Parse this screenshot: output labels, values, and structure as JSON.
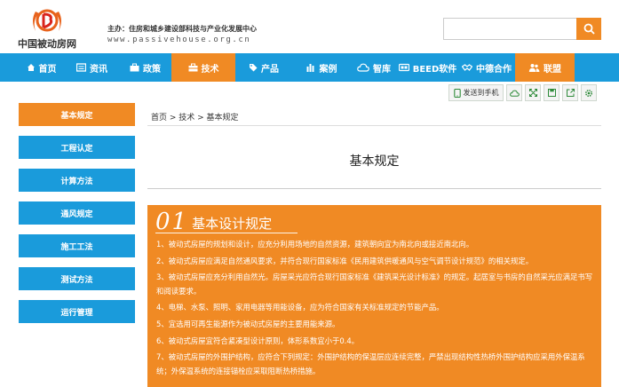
{
  "header": {
    "logo_text": "中国被动房网",
    "sponsor": "主办：住房和城乡建设部科技与产业化发展中心",
    "url": "www.passivehouse.org.cn",
    "search": {
      "placeholder": ""
    }
  },
  "nav": {
    "items": [
      {
        "label": "首页",
        "icon": "home-icon"
      },
      {
        "label": "资讯",
        "icon": "news-icon"
      },
      {
        "label": "政策",
        "icon": "briefcase-icon"
      },
      {
        "label": "技术",
        "icon": "toolbox-icon",
        "active": true
      },
      {
        "label": "产品",
        "icon": "tag-icon"
      },
      {
        "label": "案例",
        "icon": "bar-chart-icon"
      },
      {
        "label": "智库",
        "icon": "cloud-icon"
      },
      {
        "label": "BEED软件",
        "icon": "beed-icon"
      },
      {
        "label": "中德合作",
        "icon": "handshake-icon"
      },
      {
        "label": "联盟",
        "icon": "group-icon"
      }
    ]
  },
  "toolbar": {
    "send_label": "发送到手机"
  },
  "sidebar": {
    "items": [
      {
        "label": "基本规定",
        "active": true
      },
      {
        "label": "工程认定"
      },
      {
        "label": "计算方法"
      },
      {
        "label": "通风规定"
      },
      {
        "label": "施工工法"
      },
      {
        "label": "测试方法"
      },
      {
        "label": "运行管理"
      }
    ]
  },
  "breadcrumb": "首页 > 技术 > 基本规定",
  "page_title": "基本规定",
  "section": {
    "number": "01",
    "title": "基本设计规定",
    "items": [
      "1、被动式房屋的规划和设计，应充分利用场地的自然资源，建筑朝向宜为南北向或接近南北向。",
      "2、被动式房屋应满足自然通风要求，并符合现行国家标准《民用建筑供暖通风与空气调节设计规范》的相关规定。",
      "3、被动式房屋应充分利用自然光。房屋采光应符合现行国家标准《建筑采光设计标准》的规定。起居室与书房的自然采光应满足书写和阅读要求。",
      "4、电梯、水泵、照明、家用电器等用能设备，应为符合国家有关标准规定的节能产品。",
      "5、宜选用可再生能源作为被动式房屋的主要用能来源。",
      "6、被动式房屋宜符合紧凑型设计原则，体形系数宜小于0.4。",
      "7、被动式房屋的外围护结构，应符合下列规定：外围护结构的保温层应连续完整，严禁出现结构性热桥外围护结构应采用外保温系统；外保温系统的连接锚栓应采取阻断热桥措施。"
    ]
  },
  "colors": {
    "primary": "#1a9bdb",
    "accent": "#f08a24"
  }
}
